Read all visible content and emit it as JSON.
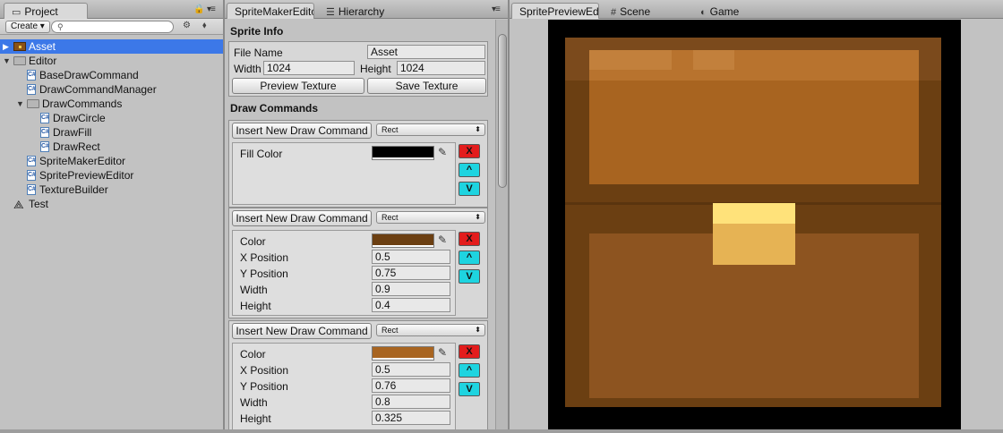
{
  "project": {
    "tab": "Project",
    "create_label": "Create",
    "search_placeholder": "",
    "items": [
      {
        "label": "Asset",
        "type": "chest",
        "level": 0,
        "selected": true
      },
      {
        "label": "Editor",
        "type": "folder",
        "level": 0,
        "expanded": true
      },
      {
        "label": "BaseDrawCommand",
        "type": "script",
        "level": 1
      },
      {
        "label": "DrawCommandManager",
        "type": "script",
        "level": 1
      },
      {
        "label": "DrawCommands",
        "type": "folder",
        "level": 1,
        "expanded": true
      },
      {
        "label": "DrawCircle",
        "type": "script",
        "level": 2
      },
      {
        "label": "DrawFill",
        "type": "script",
        "level": 2
      },
      {
        "label": "DrawRect",
        "type": "script",
        "level": 2
      },
      {
        "label": "SpriteMakerEditor",
        "type": "script",
        "level": 1
      },
      {
        "label": "SpritePreviewEditor",
        "type": "script",
        "level": 1
      },
      {
        "label": "TextureBuilder",
        "type": "script",
        "level": 1
      },
      {
        "label": "Test",
        "type": "unity",
        "level": 0
      }
    ]
  },
  "maker": {
    "tab": "SpriteMakerEdito",
    "tab_hierarchy": "Hierarchy",
    "sprite_info_title": "Sprite Info",
    "file_name_label": "File Name",
    "file_name_value": "Asset",
    "width_label": "Width",
    "width_value": "1024",
    "height_label": "Height",
    "height_value": "1024",
    "preview_btn": "Preview Texture",
    "save_btn": "Save Texture",
    "draw_commands_title": "Draw Commands",
    "insert_btn": "Insert New Draw Command",
    "dropdown_value": "Rect",
    "remove_label": "X",
    "up_label": "^",
    "down_label": "V",
    "fill_color_label": "Fill Color",
    "fill_color": "#000000",
    "rects": [
      {
        "color_label": "Color",
        "color": "#6b3f12",
        "x_label": "X Position",
        "x": "0.5",
        "y_label": "Y Position",
        "y": "0.75",
        "w_label": "Width",
        "w": "0.9",
        "h_label": "Height",
        "h": "0.4"
      },
      {
        "color_label": "Color",
        "color": "#a86420",
        "x_label": "X Position",
        "x": "0.5",
        "y_label": "Y Position",
        "y": "0.76",
        "w_label": "Width",
        "w": "0.8",
        "h_label": "Height",
        "h": "0.325"
      }
    ]
  },
  "preview": {
    "tab": "SpritePreviewEdi",
    "tab_scene": "Scene",
    "tab_game": "Game"
  }
}
